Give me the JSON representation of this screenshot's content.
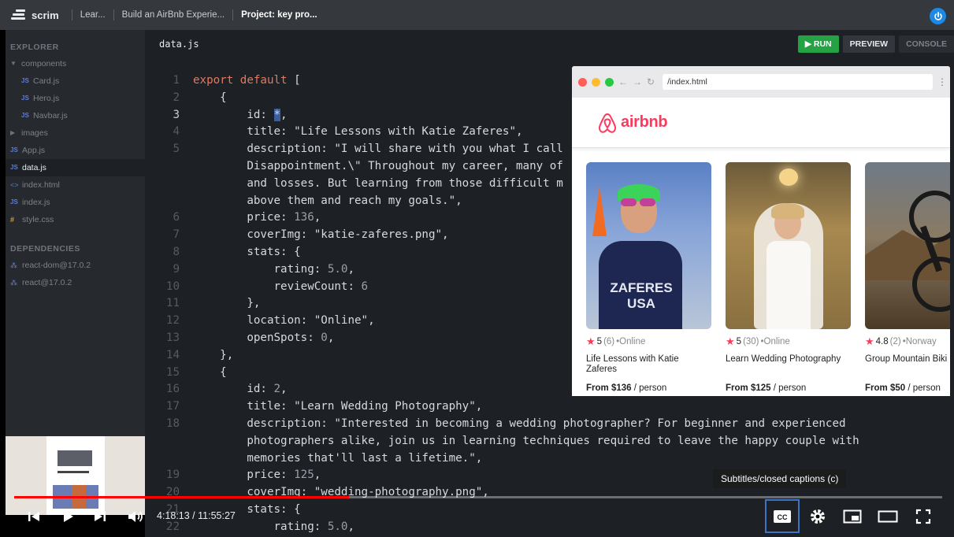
{
  "topbar": {
    "brand": "scrim",
    "breadcrumbs": [
      "Lear...",
      "Build an AirBnb Experie...",
      "Project: key pro..."
    ]
  },
  "sidebar": {
    "explorer_label": "EXPLORER",
    "dependencies_label": "DEPENDENCIES",
    "files": [
      {
        "label": "components",
        "type": "folder-open"
      },
      {
        "label": "Card.js",
        "type": "js",
        "indent": true
      },
      {
        "label": "Hero.js",
        "type": "js",
        "indent": true
      },
      {
        "label": "Navbar.js",
        "type": "js",
        "indent": true
      },
      {
        "label": "images",
        "type": "folder"
      },
      {
        "label": "App.js",
        "type": "js"
      },
      {
        "label": "data.js",
        "type": "js",
        "active": true
      },
      {
        "label": "index.html",
        "type": "html"
      },
      {
        "label": "index.js",
        "type": "js"
      },
      {
        "label": "style.css",
        "type": "css"
      }
    ],
    "dependencies": [
      "react-dom@17.0.2",
      "react@17.0.2"
    ]
  },
  "editor": {
    "filename": "data.js",
    "run_label": "▶ RUN",
    "preview_label": "PREVIEW",
    "console_label": "CONSOLE",
    "current_line": 3,
    "lines": [
      {
        "n": "1",
        "parts": [
          [
            "kw",
            "export default"
          ],
          [
            "p",
            " ["
          ]
        ]
      },
      {
        "n": "2",
        "parts": [
          [
            "p",
            "    {"
          ]
        ]
      },
      {
        "n": "3",
        "parts": [
          [
            "p",
            "        id: "
          ],
          [
            "caret",
            "*"
          ],
          [
            "p",
            ","
          ]
        ]
      },
      {
        "n": "4",
        "parts": [
          [
            "p",
            "        title: "
          ],
          [
            "str",
            "\"Life Lessons with Katie Zaferes\""
          ],
          [
            "p",
            ","
          ]
        ]
      },
      {
        "n": "5",
        "parts": [
          [
            "p",
            "        description: "
          ],
          [
            "str",
            "\"I will share with you what I call"
          ]
        ]
      },
      {
        "n": "",
        "parts": [
          [
            "str",
            "        Disappointment.\\\" Throughout my career, many of"
          ]
        ]
      },
      {
        "n": "",
        "parts": [
          [
            "str",
            "        and losses. But learning from those difficult m"
          ]
        ]
      },
      {
        "n": "",
        "parts": [
          [
            "str",
            "        above them and reach my goals.\""
          ],
          [
            "p",
            ","
          ]
        ]
      },
      {
        "n": "6",
        "parts": [
          [
            "p",
            "        price: "
          ],
          [
            "num",
            "136"
          ],
          [
            "p",
            ","
          ]
        ]
      },
      {
        "n": "7",
        "parts": [
          [
            "p",
            "        coverImg: "
          ],
          [
            "str",
            "\"katie-zaferes.png\""
          ],
          [
            "p",
            ","
          ]
        ]
      },
      {
        "n": "8",
        "parts": [
          [
            "p",
            "        stats: {"
          ]
        ]
      },
      {
        "n": "9",
        "parts": [
          [
            "p",
            "            rating: "
          ],
          [
            "num",
            "5.0"
          ],
          [
            "p",
            ","
          ]
        ]
      },
      {
        "n": "10",
        "parts": [
          [
            "p",
            "            reviewCount: "
          ],
          [
            "num",
            "6"
          ]
        ]
      },
      {
        "n": "11",
        "parts": [
          [
            "p",
            "        },"
          ]
        ]
      },
      {
        "n": "12",
        "parts": [
          [
            "p",
            "        location: "
          ],
          [
            "str",
            "\"Online\""
          ],
          [
            "p",
            ","
          ]
        ]
      },
      {
        "n": "13",
        "parts": [
          [
            "p",
            "        openSpots: "
          ],
          [
            "num",
            "0"
          ],
          [
            "p",
            ","
          ]
        ]
      },
      {
        "n": "14",
        "parts": [
          [
            "p",
            "    },"
          ]
        ]
      },
      {
        "n": "15",
        "parts": [
          [
            "p",
            "    {"
          ]
        ]
      },
      {
        "n": "16",
        "parts": [
          [
            "p",
            "        id: "
          ],
          [
            "num",
            "2"
          ],
          [
            "p",
            ","
          ]
        ]
      },
      {
        "n": "17",
        "parts": [
          [
            "p",
            "        title: "
          ],
          [
            "str",
            "\"Learn Wedding Photography\""
          ],
          [
            "p",
            ","
          ]
        ]
      },
      {
        "n": "18",
        "parts": [
          [
            "p",
            "        description: "
          ],
          [
            "str",
            "\"Interested in becoming a wedding photographer? For beginner and experienced"
          ]
        ]
      },
      {
        "n": "",
        "parts": [
          [
            "str",
            "        photographers alike, join us in learning techniques required to leave the happy couple with"
          ]
        ]
      },
      {
        "n": "",
        "parts": [
          [
            "str",
            "        memories that'll last a lifetime.\""
          ],
          [
            "p",
            ","
          ]
        ]
      },
      {
        "n": "19",
        "parts": [
          [
            "p",
            "        price: "
          ],
          [
            "num",
            "125"
          ],
          [
            "p",
            ","
          ]
        ]
      },
      {
        "n": "20",
        "parts": [
          [
            "p",
            "        coverImg: "
          ],
          [
            "str",
            "\"wedding-photography.png\""
          ],
          [
            "p",
            ","
          ]
        ]
      },
      {
        "n": "21",
        "parts": [
          [
            "p",
            "        stats: {"
          ]
        ]
      },
      {
        "n": "22",
        "parts": [
          [
            "p",
            "            rating: "
          ],
          [
            "num",
            "5.0"
          ],
          [
            "p",
            ","
          ]
        ]
      }
    ]
  },
  "preview": {
    "url": "/index.html",
    "brand": "airbnb",
    "cards": [
      {
        "rating": "5",
        "reviews": "(6)",
        "location": "•Online",
        "title": "Life Lessons with Katie Zaferes",
        "price": "From $136",
        "per": " / person"
      },
      {
        "rating": "5",
        "reviews": "(30)",
        "location": "•Online",
        "title": "Learn Wedding Photography",
        "price": "From $125",
        "per": " / person"
      },
      {
        "rating": "4.8",
        "reviews": "(2)",
        "location": "•Norway",
        "title": "Group Mountain Biki",
        "price": "From $50",
        "per": " / person"
      }
    ]
  },
  "player": {
    "time": "4:18:13 / 11:55:27",
    "progress": 0.361,
    "tooltip": "Subtitles/closed captions (c)"
  },
  "colors": {
    "accent_red": "#ff385c",
    "run_green": "#25a244",
    "progress_red": "#ff0000"
  }
}
